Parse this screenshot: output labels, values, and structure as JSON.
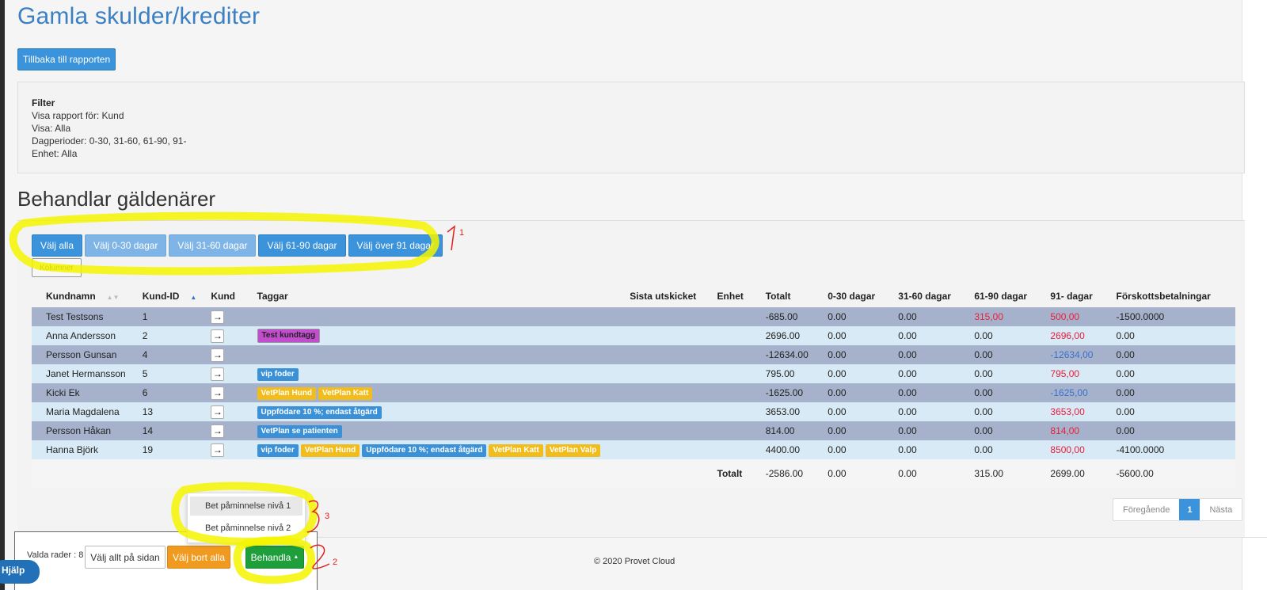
{
  "page": {
    "title": "Gamla skulder/krediter",
    "back_button": "Tillbaka till rapporten"
  },
  "filter": {
    "title": "Filter",
    "lines": [
      "Visa rapport för: Kund",
      "Visa: Alla",
      "Dagperioder: 0-30, 31-60, 61-90, 91-",
      "Enhet: Alla"
    ]
  },
  "section_title": "Behandlar gäldenärer",
  "select_buttons": [
    "Välj alla",
    "Välj 0-30 dagar",
    "Välj 31-60 dagar",
    "Välj 61-90 dagar",
    "Välj över 91 dagar"
  ],
  "columns_button": "Kolumner",
  "table": {
    "headers": [
      "Kundnamn",
      "Kund-ID",
      "Kund",
      "Taggar",
      "Sista utskicket",
      "Enhet",
      "Totalt",
      "0-30 dagar",
      "31-60 dagar",
      "61-90 dagar",
      "91- dagar",
      "Förskottsbetalningar"
    ],
    "rows": [
      {
        "name": "Test Testsons",
        "id": "1",
        "tags": [],
        "total": "-685.00",
        "d0_30": "0.00",
        "d31_60": "0.00",
        "d61_90": "315,00",
        "d91": "500,00",
        "prepay": "-1500.0000"
      },
      {
        "name": "Anna Andersson",
        "id": "2",
        "tags": [
          {
            "label": "Test kundtagg",
            "color": "magenta"
          }
        ],
        "total": "2696.00",
        "d0_30": "0.00",
        "d31_60": "0.00",
        "d61_90": "0.00",
        "d91": "2696,00",
        "prepay": "0.00"
      },
      {
        "name": "Persson Gunsan",
        "id": "4",
        "tags": [],
        "total": "-12634.00",
        "d0_30": "0.00",
        "d31_60": "0.00",
        "d61_90": "0.00",
        "d91": "-12634,00",
        "prepay": "0.00"
      },
      {
        "name": "Janet Hermansson",
        "id": "5",
        "tags": [
          {
            "label": "vip foder",
            "color": "blue"
          }
        ],
        "total": "795.00",
        "d0_30": "0.00",
        "d31_60": "0.00",
        "d61_90": "0.00",
        "d91": "795,00",
        "prepay": "0.00"
      },
      {
        "name": "Kicki Ek",
        "id": "6",
        "tags": [
          {
            "label": "VetPlan Hund",
            "color": "yellow"
          },
          {
            "label": "VetPlan Katt",
            "color": "yellow"
          }
        ],
        "total": "-1625.00",
        "d0_30": "0.00",
        "d31_60": "0.00",
        "d61_90": "0.00",
        "d91": "-1625,00",
        "prepay": "0.00"
      },
      {
        "name": "Maria Magdalena",
        "id": "13",
        "tags": [
          {
            "label": "Uppfödare 10 %; endast åtgärd",
            "color": "blue"
          }
        ],
        "total": "3653.00",
        "d0_30": "0.00",
        "d31_60": "0.00",
        "d61_90": "0.00",
        "d91": "3653,00",
        "prepay": "0.00"
      },
      {
        "name": "Persson Håkan",
        "id": "14",
        "tags": [
          {
            "label": "VetPlan se patienten",
            "color": "blue"
          }
        ],
        "total": "814.00",
        "d0_30": "0.00",
        "d31_60": "0.00",
        "d61_90": "0.00",
        "d91": "814,00",
        "prepay": "0.00"
      },
      {
        "name": "Hanna Björk",
        "id": "19",
        "tags": [
          {
            "label": "vip foder",
            "color": "blue"
          },
          {
            "label": "VetPlan Hund",
            "color": "yellow"
          },
          {
            "label": "Uppfödare 10 %; endast åtgärd",
            "color": "blue"
          },
          {
            "label": "VetPlan Katt",
            "color": "yellow"
          },
          {
            "label": "VetPlan Valp",
            "color": "yellow"
          }
        ],
        "total": "4400.00",
        "d0_30": "0.00",
        "d31_60": "0.00",
        "d61_90": "0.00",
        "d91": "8500,00",
        "prepay": "-4100.0000"
      }
    ],
    "totals": {
      "label": "Totalt",
      "total": "-2586.00",
      "d0_30": "0.00",
      "d31_60": "0.00",
      "d61_90": "315.00",
      "d91": "2699.00",
      "prepay": "-5600.00"
    }
  },
  "pagination": {
    "prev": "Föregående",
    "current": "1",
    "next": "Nästa"
  },
  "bottom_bar": {
    "rows_label": "Valda rader : 8",
    "select_page": "Välj allt på sidan",
    "deselect_all": "Välj bort alla",
    "process": "Behandla",
    "dropdown_items": [
      "Bet påminnelse nivå 1",
      "Bet påminnelse nivå 2"
    ]
  },
  "footer": {
    "copyright": "© 2020 Provet Cloud"
  },
  "help_button": "Hjälp",
  "annotations": {
    "marker_1": "1",
    "marker_2": "2",
    "marker_3": "3"
  },
  "colors": {
    "title_blue": "#3c80c4",
    "btn_blue": "#3a93db",
    "btn_orange": "#f09a20",
    "btn_green": "#1f9e3c",
    "row_dark": "#a6b2cc",
    "row_light": "#d7eaf5",
    "negative_text": "#e5203c",
    "highlight_yellow": "#f5f500",
    "annotation_red": "#e0201c"
  }
}
